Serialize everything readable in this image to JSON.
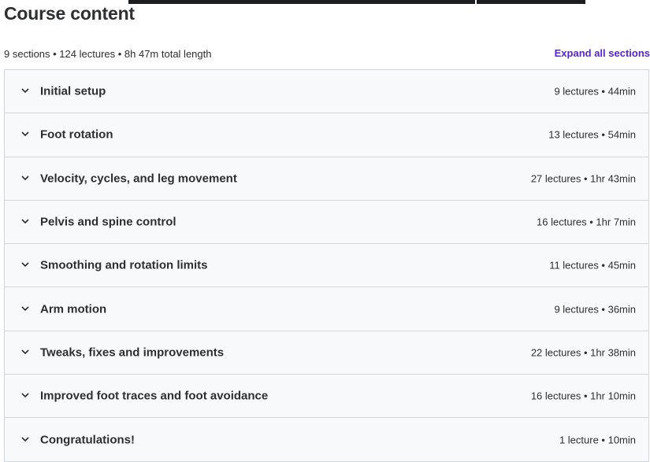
{
  "header": {
    "title": "Course content",
    "summary": "9 sections • 124 lectures • 8h 47m total length",
    "expand_label": "Expand all sections"
  },
  "sections": [
    {
      "title": "Initial setup",
      "meta": "9 lectures • 44min"
    },
    {
      "title": "Foot rotation",
      "meta": "13 lectures • 54min"
    },
    {
      "title": "Velocity, cycles, and leg movement",
      "meta": "27 lectures • 1hr 43min"
    },
    {
      "title": "Pelvis and spine control",
      "meta": "16 lectures • 1hr 7min"
    },
    {
      "title": "Smoothing and rotation limits",
      "meta": "11 lectures • 45min"
    },
    {
      "title": "Arm motion",
      "meta": "9 lectures • 36min"
    },
    {
      "title": "Tweaks, fixes and improvements",
      "meta": "22 lectures • 1hr 38min"
    },
    {
      "title": "Improved foot traces and foot avoidance",
      "meta": "16 lectures • 1hr 10min"
    },
    {
      "title": "Congratulations!",
      "meta": "1 lecture • 10min"
    }
  ],
  "icons": {
    "section_toggle": "chevron-down-icon"
  },
  "colors": {
    "accent": "#5624d0",
    "text": "#2d2f31",
    "section_bg": "#f7f9fa",
    "border": "#d1d7dc"
  }
}
